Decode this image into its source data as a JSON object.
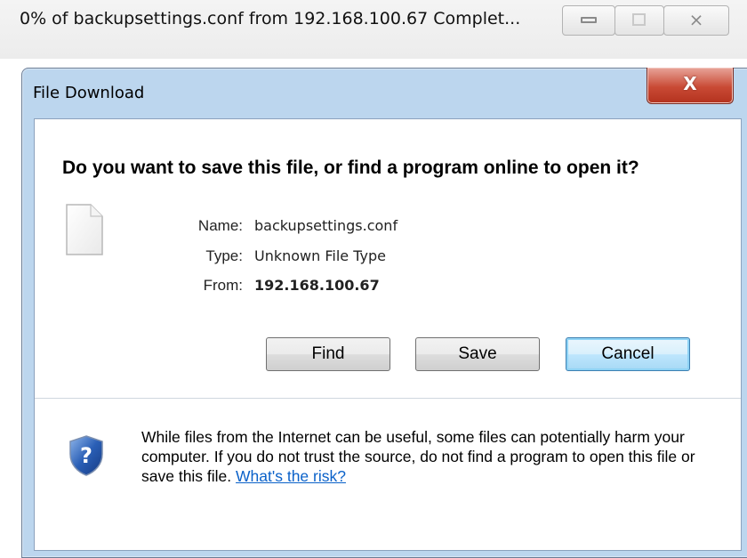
{
  "background_window": {
    "title": "0% of backupsettings.conf from 192.168.100.67 Complet...",
    "controls": {
      "minimize": "minimize-icon",
      "maximize": "maximize-icon",
      "close": "close-icon"
    }
  },
  "dialog": {
    "title": "File Download",
    "close_glyph": "X",
    "question": "Do you want to save this file, or find a program online to open it?",
    "file_icon": "document-icon",
    "info": [
      {
        "label": "Name:",
        "value": "backupsettings.conf"
      },
      {
        "label": "Type:",
        "value": "Unknown File Type"
      },
      {
        "label": "From:",
        "value": "192.168.100.67"
      }
    ],
    "buttons": {
      "find": "Find",
      "save": "Save",
      "cancel": "Cancel"
    },
    "warning": {
      "icon": "security-shield-icon",
      "text": "While files from the Internet can be useful, some files can potentially harm your computer. If you do not trust the source, do not find a program to open this file or save this file.",
      "link": "What's the risk?"
    }
  },
  "colors": {
    "dialog_frame": "#bcd6ee",
    "close_button": "#c94a35",
    "link": "#0a61c9",
    "default_button_glow": "#8fd3f5"
  }
}
